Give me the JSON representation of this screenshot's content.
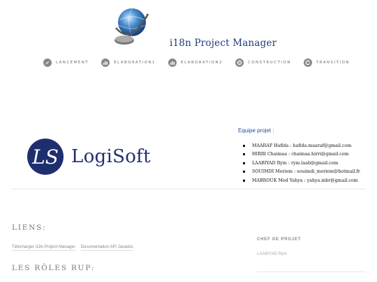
{
  "header": {
    "site_title": "i18n Project Manager"
  },
  "nav": {
    "items": [
      {
        "label": "LANCEMENT",
        "icon": "rocket-icon"
      },
      {
        "label": "ELABORATION1",
        "icon": "bar-chart-icon"
      },
      {
        "label": "ELABORATION2",
        "icon": "bar-chart-icon"
      },
      {
        "label": "CONSTRUCTION",
        "icon": "gear-icon"
      },
      {
        "label": "TRANSITION",
        "icon": "refresh-icon"
      }
    ]
  },
  "logo": {
    "text": "LogiSoft",
    "emblem": "LS",
    "color": "#1f2f6e"
  },
  "team": {
    "title": "Equipe projet :",
    "members": [
      "MAARAF Hafida : hafida.maaraf@gmail.com",
      "HIRRI Chaimaa : chaimaa.hirri@gmail.com",
      "LAABIYAD Rym : rym.laab@gmail.com",
      "SOUIMDI Meriem : souimdi_meriem@hotmail.fr",
      "MABROUK Med Yahya : yahya.mbr@gmail.com"
    ]
  },
  "sections": {
    "liens_title": "LIENS:",
    "links": [
      "Télécharger i18n Project Manager",
      "Documentation API Javadoc"
    ],
    "roles_title": "LES RÔLES RUP:"
  },
  "sidebar": {
    "chef_title": "CHEF DE PROJET",
    "chef_name": "LAABIYAD Rym"
  }
}
